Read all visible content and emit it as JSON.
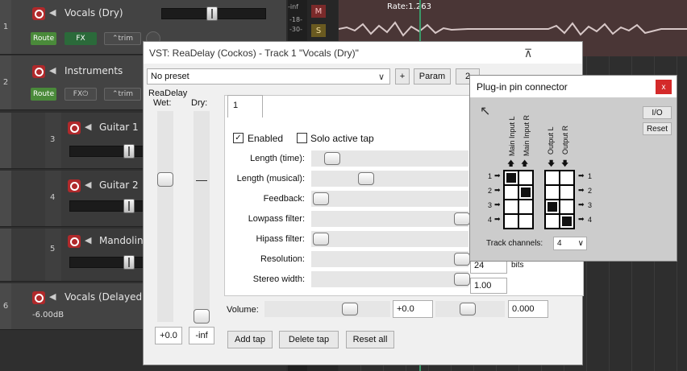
{
  "tracks": [
    {
      "num": "1",
      "name": "Vocals (Dry)",
      "route": "Route",
      "fx": "FX",
      "trim": "trim",
      "meter": [
        "-inf",
        "-18-",
        "-30-"
      ],
      "btn_m": "M",
      "btn_s": "S"
    },
    {
      "num": "2",
      "name": "Instruments",
      "route": "Route",
      "fx": "FX",
      "trim": "trim"
    },
    {
      "num": "3",
      "name": "Guitar 1"
    },
    {
      "num": "4",
      "name": "Guitar 2"
    },
    {
      "num": "5",
      "name": "Mandolin"
    },
    {
      "num": "6",
      "name": "Vocals (Delayed)",
      "volume": "-6.00dB"
    }
  ],
  "item": {
    "rate": "Rate:1.263"
  },
  "vst": {
    "title": "VST: ReaDelay (Cockos) - Track 1 \"Vocals (Dry)\"",
    "preset": "No preset",
    "plus": "+",
    "param": "Param",
    "partial_btn": "2",
    "plugin_name": "ReaDelay",
    "wet_label": "Wet:",
    "dry_label": "Dry:",
    "wet_value": "+0.0",
    "dry_value": "-inf",
    "tab": "1",
    "enabled": "Enabled",
    "solo": "Solo active tap",
    "params": [
      {
        "label": "Length (time):",
        "level": 0.08
      },
      {
        "label": "Length (musical):",
        "level": 0.32
      },
      {
        "label": "Feedback:",
        "level": 0.0
      },
      {
        "label": "Lowpass filter:",
        "level": 1.0
      },
      {
        "label": "Hipass filter:",
        "level": 0.0
      },
      {
        "label": "Resolution:",
        "level": 1.0,
        "value": "24",
        "unit": "bits"
      },
      {
        "label": "Stereo width:",
        "level": 1.0,
        "value": "1.00"
      }
    ],
    "volume_label": "Volume:",
    "volume_value": "+0.0",
    "pan_value": "0.000",
    "add_tap": "Add tap",
    "delete_tap": "Delete tap",
    "reset_all": "Reset all"
  },
  "pin": {
    "title": "Plug-in pin connector",
    "close": "x",
    "io": "I/O",
    "reset": "Reset",
    "in_labels": [
      "Main Input L",
      "Main Input R"
    ],
    "out_labels": [
      "Output L",
      "Output R"
    ],
    "rows": [
      "1",
      "2",
      "3",
      "4"
    ],
    "track_channels_label": "Track channels:",
    "track_channels_value": "4"
  }
}
